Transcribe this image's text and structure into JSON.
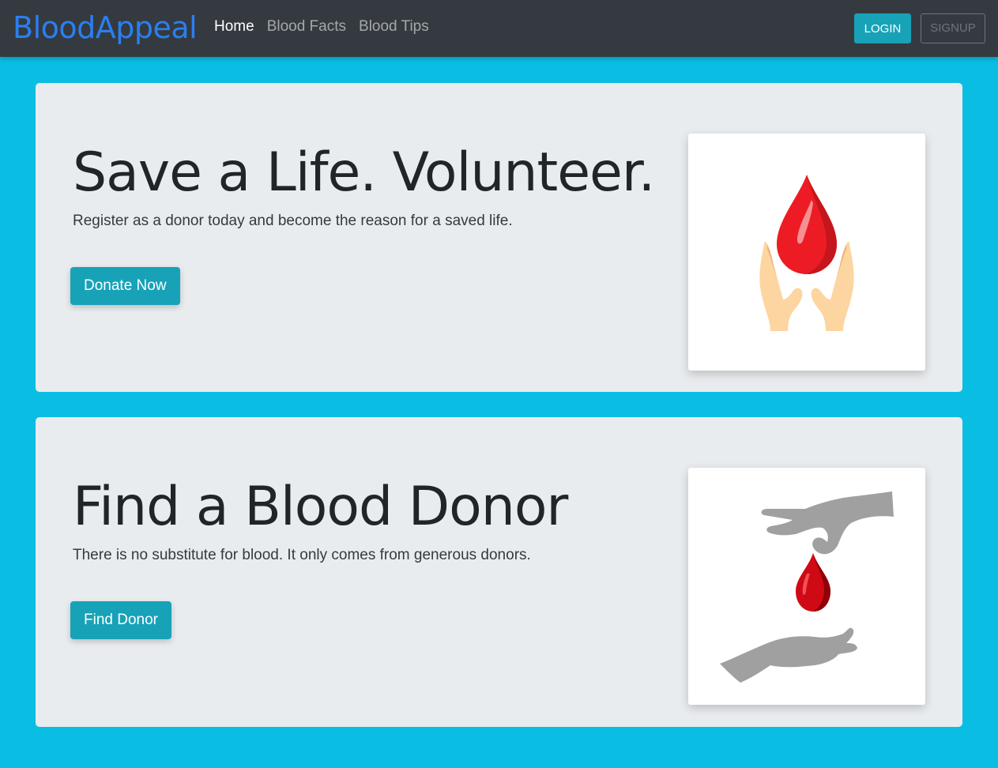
{
  "navbar": {
    "brand": "BloodAppeal",
    "links": [
      {
        "label": "Home",
        "active": true
      },
      {
        "label": "Blood Facts",
        "active": false
      },
      {
        "label": "Blood Tips",
        "active": false
      }
    ],
    "login_label": "LOGIN",
    "signup_label": "SIGNUP"
  },
  "sections": [
    {
      "title": "Save a Life. Volunteer.",
      "subtitle": "Register as a donor today and become the reason for a saved life.",
      "button": "Donate Now",
      "image_icon": "blood-drop-hands-icon"
    },
    {
      "title": "Find a Blood Donor",
      "subtitle": "There is no substitute for blood. It only comes from generous donors.",
      "button": "Find Donor",
      "image_icon": "hands-passing-blood-drop-icon"
    }
  ],
  "colors": {
    "page_bg": "#0abde3",
    "navbar_bg": "#343a40",
    "brand": "#2a7ff0",
    "accent": "#17a2b8",
    "jumbotron_bg": "#e9ecef",
    "blood_red": "#ed1c24"
  }
}
